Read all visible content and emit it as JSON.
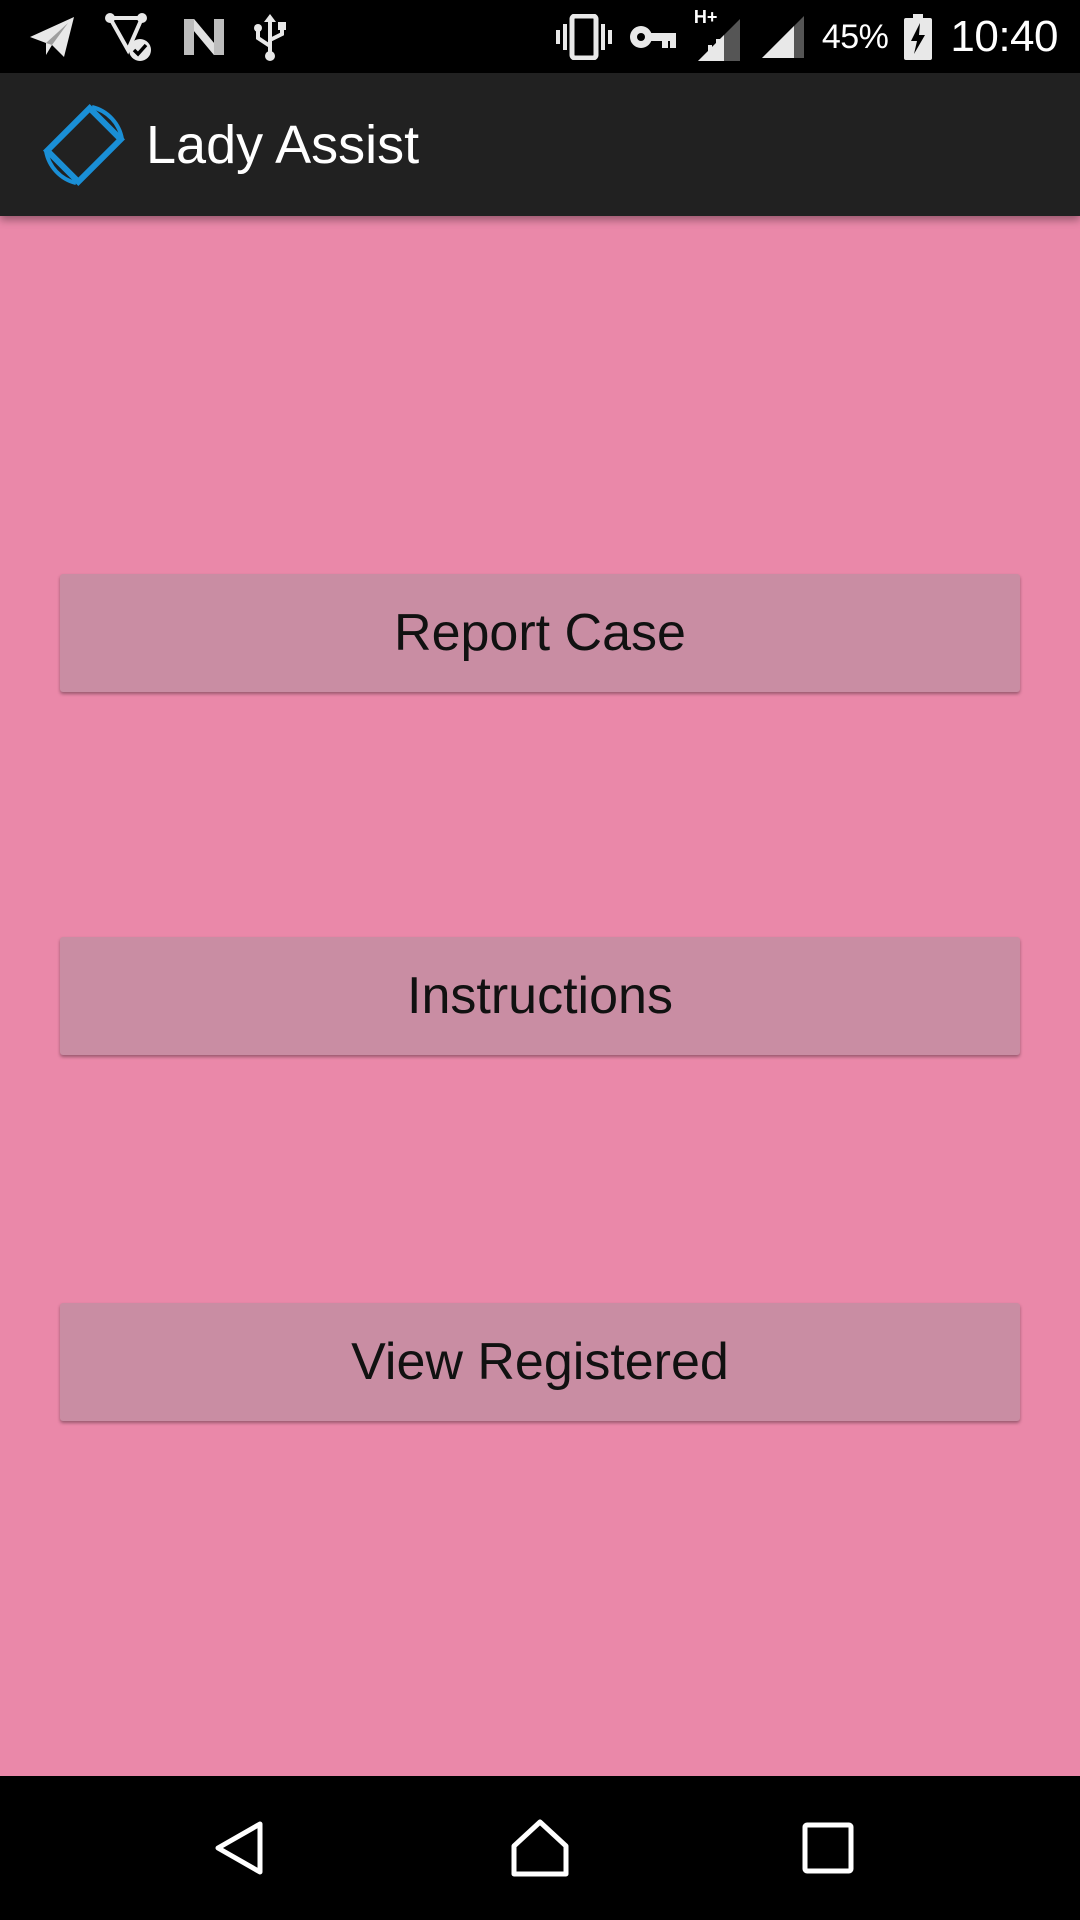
{
  "status_bar": {
    "battery_percent": "45%",
    "time": "10:40",
    "network_label": "H+",
    "left_icons": [
      "send-icon",
      "location-check-icon",
      "n-logo-icon",
      "usb-icon"
    ],
    "right_icons": [
      "vibrate-icon",
      "vpn-key-icon",
      "signal-h-plus-icon",
      "signal-icon",
      "battery-charging-icon"
    ]
  },
  "app_bar": {
    "title": "Lady Assist",
    "logo_icon": "screen-rotation-icon",
    "logo_color": "#1a8fd6"
  },
  "main": {
    "background_color": "#ea88a9",
    "button_color": "#c98da3",
    "buttons": [
      {
        "label": "Report Case"
      },
      {
        "label": "Instructions"
      },
      {
        "label": "View Registered"
      }
    ]
  },
  "nav_bar": {
    "icons": [
      "back-icon",
      "home-icon",
      "recents-icon"
    ]
  }
}
